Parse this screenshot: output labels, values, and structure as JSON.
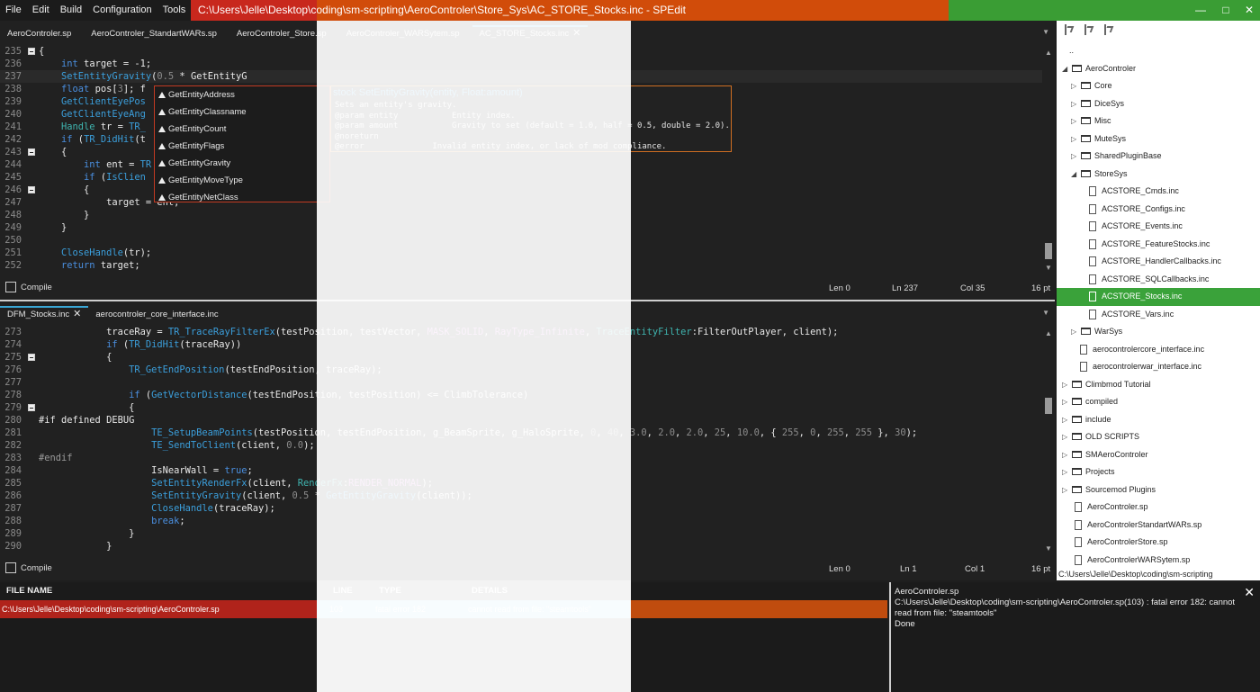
{
  "menu": [
    "File",
    "Edit",
    "Build",
    "Configuration",
    "Tools"
  ],
  "window_title": "C:\\Users\\Jelle\\Desktop\\coding\\sm-scripting\\AeroControler\\Store_Sys\\AC_STORE_Stocks.inc - SPEdit",
  "window_buttons": {
    "minimize": "—",
    "maximize": "□",
    "close": "✕"
  },
  "top_pane": {
    "tabs": [
      "AeroControler.sp",
      "AeroControler_StandartWARs.sp",
      "AeroControler_Store.sp",
      "AeroControler_WARSytem.sp",
      "AC_STORE_Stocks.inc"
    ],
    "active_tab_index": 4,
    "status": {
      "compile": "Compile",
      "len": "Len 0",
      "ln": "Ln 237",
      "col": "Col 35",
      "pt": "16 pt"
    }
  },
  "bottom_pane": {
    "tabs": [
      "DFM_Stocks.inc",
      "aerocontroler_core_interface.inc"
    ],
    "active_tab_index": 0,
    "status": {
      "compile": "Compile",
      "len": "Len 0",
      "ln": "Ln 1",
      "col": "Col 1",
      "pt": "16 pt"
    }
  },
  "autocomplete": [
    "GetEntityAddress",
    "GetEntityClassname",
    "GetEntityCount",
    "GetEntityFlags",
    "GetEntityGravity",
    "GetEntityMoveType",
    "GetEntityNetClass"
  ],
  "tooltip": {
    "signature": "stock SetEntityGravity(entity, Float:amount)",
    "doc": "Sets an entity's gravity.\n@param entity           Entity index.\n@param amount           Gravity to set (default = 1.0, half = 0.5, double = 2.0).\n@noreturn\n@error              Invalid entity index, or lack of mod compliance."
  },
  "sidebar": {
    "tree": [
      {
        "label": "..",
        "depth": 0,
        "kind": "none"
      },
      {
        "label": "AeroControler",
        "depth": 0,
        "kind": "folder",
        "open": true
      },
      {
        "label": "Core",
        "depth": 1,
        "kind": "folder"
      },
      {
        "label": "DiceSys",
        "depth": 1,
        "kind": "folder"
      },
      {
        "label": "Misc",
        "depth": 1,
        "kind": "folder"
      },
      {
        "label": "MuteSys",
        "depth": 1,
        "kind": "folder"
      },
      {
        "label": "SharedPluginBase",
        "depth": 1,
        "kind": "folder"
      },
      {
        "label": "StoreSys",
        "depth": 1,
        "kind": "folder",
        "open": true
      },
      {
        "label": "ACSTORE_Cmds.inc",
        "depth": 2,
        "kind": "file"
      },
      {
        "label": "ACSTORE_Configs.inc",
        "depth": 2,
        "kind": "file"
      },
      {
        "label": "ACSTORE_Events.inc",
        "depth": 2,
        "kind": "file"
      },
      {
        "label": "ACSTORE_FeatureStocks.inc",
        "depth": 2,
        "kind": "file"
      },
      {
        "label": "ACSTORE_HandlerCallbacks.inc",
        "depth": 2,
        "kind": "file"
      },
      {
        "label": "ACSTORE_SQLCallbacks.inc",
        "depth": 2,
        "kind": "file"
      },
      {
        "label": "ACSTORE_Stocks.inc",
        "depth": 2,
        "kind": "file",
        "selected": true
      },
      {
        "label": "ACSTORE_Vars.inc",
        "depth": 2,
        "kind": "file"
      },
      {
        "label": "WarSys",
        "depth": 1,
        "kind": "folder"
      },
      {
        "label": "aerocontrolercore_interface.inc",
        "depth": 1,
        "kind": "file"
      },
      {
        "label": "aerocontrolerwar_interface.inc",
        "depth": 1,
        "kind": "file"
      },
      {
        "label": "Climbmod Tutorial",
        "depth": 0,
        "kind": "folder"
      },
      {
        "label": "compiled",
        "depth": 0,
        "kind": "folder"
      },
      {
        "label": "include",
        "depth": 0,
        "kind": "folder"
      },
      {
        "label": "OLD SCRIPTS",
        "depth": 0,
        "kind": "folder"
      },
      {
        "label": "SMAeroControler",
        "depth": 0,
        "kind": "folder"
      },
      {
        "label": "Projects",
        "depth": 0,
        "kind": "folder"
      },
      {
        "label": "Sourcemod Plugins",
        "depth": 0,
        "kind": "folder"
      },
      {
        "label": "AeroControler.sp",
        "depth": 0,
        "kind": "file"
      },
      {
        "label": "AeroControlerStandartWARs.sp",
        "depth": 0,
        "kind": "file"
      },
      {
        "label": "AeroControlerStore.sp",
        "depth": 0,
        "kind": "file"
      },
      {
        "label": "AeroControlerWARSytem.sp",
        "depth": 0,
        "kind": "file"
      }
    ],
    "path": "C:\\Users\\Jelle\\Desktop\\coding\\sm-scripting"
  },
  "errors": {
    "headers": {
      "file": "FILE NAME",
      "line": "LINE",
      "type": "TYPE",
      "details": "DETAILS"
    },
    "rows": [
      {
        "file": "C:\\Users\\Jelle\\Desktop\\coding\\sm-scripting\\AeroControler.sp",
        "line": "103",
        "type": "fatal error 182",
        "details": "cannot read from file: \"steamtools\""
      }
    ]
  },
  "output": {
    "text": "AeroControler.sp\nC:\\Users\\Jelle\\Desktop\\coding\\sm-scripting\\AeroControler.sp(103) : fatal error 182: cannot\nread from file: \"steamtools\"\nDone",
    "close": "✕"
  },
  "colors": {
    "accent": "#3aa7d6",
    "title_orange": "#d14c0a",
    "title_red": "#c8281d",
    "title_green": "#3a9d34",
    "error_row": "#b0231b",
    "sidebar_selected": "#3aa23a"
  }
}
